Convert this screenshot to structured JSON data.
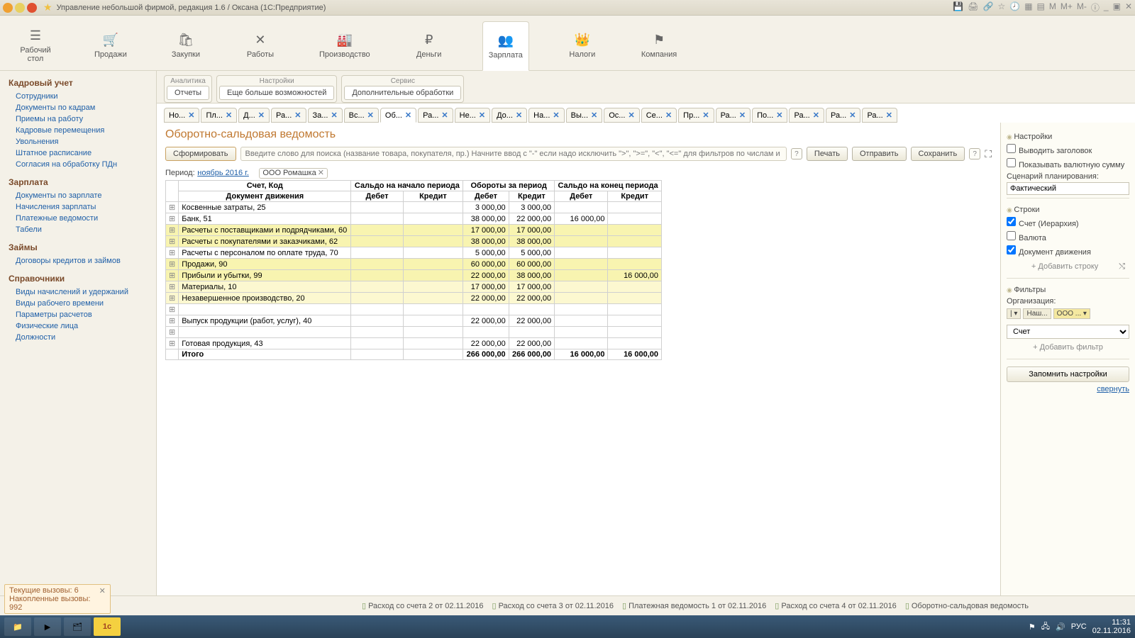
{
  "window": {
    "title": "Управление небольшой фирмой, редакция 1.6 / Оксана  (1С:Предприятие)"
  },
  "mainTabs": [
    {
      "icon": "☰",
      "label": "Рабочий\nстол"
    },
    {
      "icon": "🛒",
      "label": "Продажи"
    },
    {
      "icon": "🛍",
      "label": "Закупки"
    },
    {
      "icon": "✕",
      "label": "Работы"
    },
    {
      "icon": "🏭",
      "label": "Производство"
    },
    {
      "icon": "₽",
      "label": "Деньги"
    },
    {
      "icon": "👥",
      "label": "Зарплата",
      "active": true
    },
    {
      "icon": "👑",
      "label": "Налоги"
    },
    {
      "icon": "⚑",
      "label": "Компания"
    }
  ],
  "sidebar": [
    {
      "head": "Кадровый учет",
      "items": [
        "Сотрудники",
        "Документы по кадрам",
        "Приемы на работу",
        "Кадровые перемещения",
        "Увольнения",
        "Штатное расписание",
        "Согласия на обработку ПДн"
      ]
    },
    {
      "head": "Зарплата",
      "items": [
        "Документы по зарплате",
        "Начисления зарплаты",
        "Платежные ведомости",
        "Табели"
      ]
    },
    {
      "head": "Займы",
      "items": [
        "Договоры кредитов и займов"
      ]
    },
    {
      "head": "Справочники",
      "items": [
        "Виды начислений и удержаний",
        "Виды рабочего времени",
        "Параметры расчетов",
        "Физические лица",
        "Должности"
      ]
    }
  ],
  "subTabs": {
    "g1": {
      "title": "Аналитика",
      "btn": "Отчеты"
    },
    "g2": {
      "title": "Настройки",
      "btn": "Еще больше возможностей"
    },
    "g3": {
      "title": "Сервис",
      "btn": "Дополнительные обработки"
    }
  },
  "docTabs": [
    "Но...",
    "Пл...",
    "Д...",
    "Ра...",
    "За...",
    "Вс...",
    "Об...",
    "Ра...",
    "Не...",
    "До...",
    "На...",
    "Вы...",
    "Ос...",
    "Се...",
    "Пр...",
    "Ра...",
    "По...",
    "Ра...",
    "Ра...",
    "Ра..."
  ],
  "docActiveIndex": 6,
  "doc": {
    "title": "Оборотно-сальдовая ведомость",
    "btnForm": "Сформировать",
    "searchPlaceholder": "Введите слово для поиска (название товара, покупателя, пр.) Начните ввод с \"-\" если надо исключить \">\", \">=\", \"<\", \"<=\" для фильтров по числам и датамВозьмите",
    "btnPrint": "Печать",
    "btnSend": "Отправить",
    "btnSave": "Сохранить",
    "periodLabel": "Период:",
    "periodValue": "ноябрь 2016 г.",
    "chip": "ООО Ромашка"
  },
  "report": {
    "h1": "Счет, Код",
    "h2": "Сальдо на начало периода",
    "h3": "Обороты за период",
    "h4": "Сальдо на конец периода",
    "sub1": "Документ движения",
    "d": "Дебет",
    "k": "Кредит",
    "rows": [
      {
        "n": "Косвенные затраты, 25",
        "od": "3 000,00",
        "ok": "3 000,00"
      },
      {
        "n": "Банк, 51",
        "od": "38 000,00",
        "ok": "22 000,00",
        "ed": "16 000,00"
      },
      {
        "n": "Расчеты с поставщиками и подрядчиками, 60",
        "od": "17 000,00",
        "ok": "17 000,00",
        "hl": 1
      },
      {
        "n": "Расчеты с покупателями и заказчиками, 62",
        "od": "38 000,00",
        "ok": "38 000,00",
        "hl": 1
      },
      {
        "n": "Расчеты с персоналом по оплате труда, 70",
        "od": "5 000,00",
        "ok": "5 000,00"
      },
      {
        "n": "Продажи, 90",
        "od": "60 000,00",
        "ok": "60 000,00",
        "hl": 1
      },
      {
        "n": "Прибыли и убытки, 99",
        "od": "22 000,00",
        "ok": "38 000,00",
        "ek": "16 000,00",
        "hl": 1
      },
      {
        "n": "Материалы, 10",
        "od": "17 000,00",
        "ok": "17 000,00",
        "hl": 2
      },
      {
        "n": "Незавершенное производство, 20",
        "od": "22 000,00",
        "ok": "22 000,00",
        "hl": 2
      },
      {
        "n": "",
        "blank": 1
      },
      {
        "n": "Выпуск продукции (работ, услуг), 40",
        "od": "22 000,00",
        "ok": "22 000,00"
      },
      {
        "n": "",
        "blank": 1
      },
      {
        "n": "Готовая продукция, 43",
        "od": "22 000,00",
        "ok": "22 000,00"
      }
    ],
    "total": {
      "n": "Итого",
      "od": "266 000,00",
      "ok": "266 000,00",
      "ed": "16 000,00",
      "ek": "16 000,00"
    }
  },
  "rightPanel": {
    "settings": "Настройки",
    "showHeader": "Выводить заголовок",
    "showCurrency": "Показывать валютную сумму",
    "scenario": "Сценарий планирования:",
    "scenarioVal": "Фактический",
    "rows": "Строки",
    "rAccount": "Счет (Иерархия)",
    "rCurrency": "Валюта",
    "rDocMove": "Документ движения",
    "addRow": "+ Добавить строку",
    "filters": "Фильтры",
    "org": "Организация:",
    "orgChips": [
      "| ▾",
      "Наш...",
      "ООО ... ▾"
    ],
    "acct": "Счет",
    "addFilter": "+ Добавить фильтр",
    "save": "Запомнить настройки",
    "collapse": "свернуть"
  },
  "statusBar": {
    "items": [
      "Расход со счета 2 от 02.11.2016",
      "Расход со счета 3 от 02.11.2016",
      "Платежная ведомость 1 от 02.11.2016",
      "Расход со счета 4 от 02.11.2016",
      "Оборотно-сальдовая ведомость"
    ]
  },
  "calls": {
    "line1": "Текущие вызовы: 6",
    "line2": "Накопленные вызовы: 992"
  },
  "taskbar": {
    "time": "11:31",
    "date": "02.11.2016",
    "lang": "РУС"
  }
}
